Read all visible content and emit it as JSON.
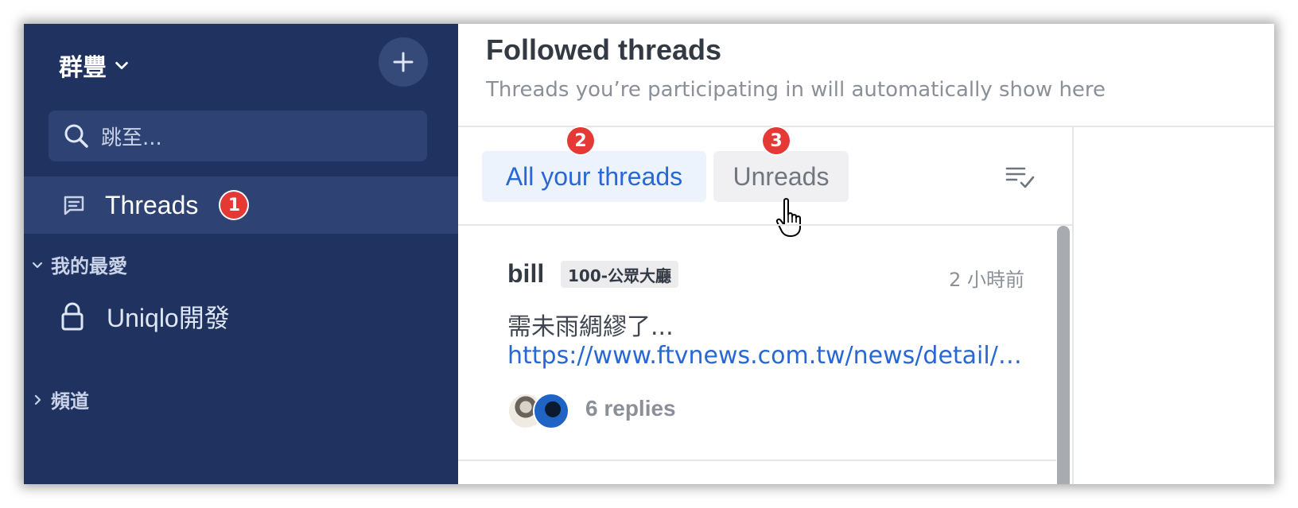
{
  "sidebar": {
    "workspace_name": "群豐",
    "search_placeholder": "跳至...",
    "threads_label": "Threads",
    "threads_callout": "1",
    "favorites_header": "我的最愛",
    "favorite_channel": "Uniqlo開發",
    "channels_header": "頻道"
  },
  "main": {
    "title": "Followed threads",
    "subtitle": "Threads you’re participating in will automatically show here",
    "tabs": [
      {
        "label": "All your threads",
        "callout": "2",
        "active": true
      },
      {
        "label": "Unreads",
        "callout": "3",
        "active": false
      }
    ],
    "threads": [
      {
        "author": "bill",
        "channel_tag": "100-公眾大廳",
        "time": "2 小時前",
        "message": "需未雨綢繆了...",
        "link": "https://www.ftvnews.com.tw/news/detail/2...",
        "replies": "6 replies"
      }
    ]
  },
  "colors": {
    "sidebar_bg": "#1f3260",
    "sidebar_active_bg": "#2e4373",
    "accent": "#2867d6",
    "callout": "#e53935"
  },
  "icons": [
    "chevron-down-icon",
    "plus-icon",
    "search-icon",
    "threads-icon",
    "chevron-right-icon",
    "lock-icon",
    "filter-check-icon",
    "hand-cursor-icon"
  ]
}
